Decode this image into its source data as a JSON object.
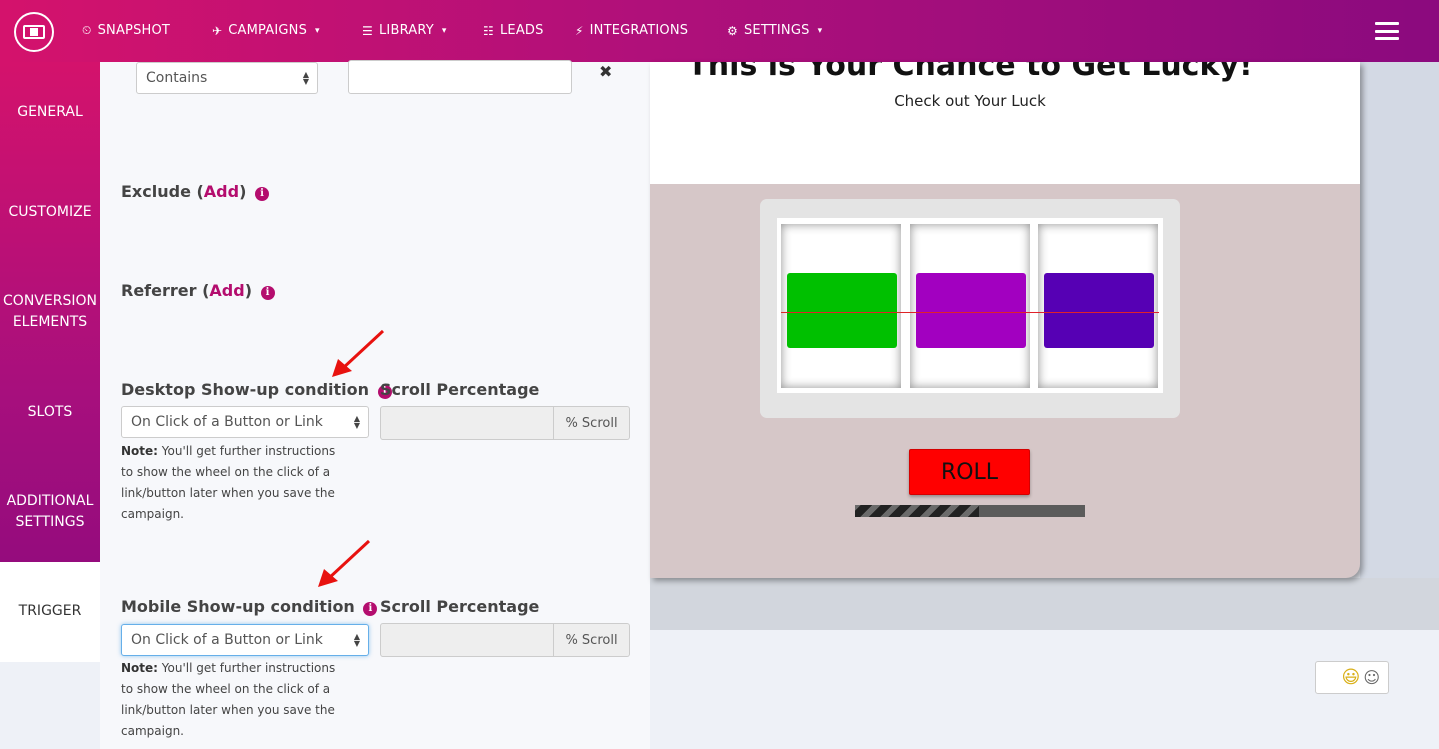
{
  "nav": {
    "items": [
      {
        "label": "SNAPSHOT",
        "icon": "dashboard-icon",
        "glyph": "⏲",
        "caret": false
      },
      {
        "label": "CAMPAIGNS",
        "icon": "paper-plane-icon",
        "glyph": "✈",
        "caret": true
      },
      {
        "label": "LIBRARY",
        "icon": "library-icon",
        "glyph": "☰",
        "caret": true
      },
      {
        "label": "LEADS",
        "icon": "list-icon",
        "glyph": "☷",
        "caret": false
      },
      {
        "label": "INTEGRATIONS",
        "icon": "plug-icon",
        "glyph": "⚡",
        "caret": false
      },
      {
        "label": "SETTINGS",
        "icon": "cogs-icon",
        "glyph": "⚙",
        "caret": true
      }
    ],
    "caret_glyph": "▾"
  },
  "sidebar": {
    "items": [
      {
        "label": "GENERAL",
        "active": false
      },
      {
        "label": "CUSTOMIZE",
        "active": false
      },
      {
        "label": "CONVERSION ELEMENTS",
        "active": false
      },
      {
        "label": "SLOTS",
        "active": false
      },
      {
        "label": "ADDITIONAL SETTINGS",
        "active": false
      },
      {
        "label": "TRIGGER",
        "active": true
      }
    ]
  },
  "form": {
    "contains_select": "Contains",
    "contains_value": "",
    "remove_glyph": "✖",
    "exclude": {
      "label": "Exclude (",
      "add": "Add",
      "close": ")"
    },
    "referrer": {
      "label": "Referrer (",
      "add": "Add",
      "close": ")"
    },
    "info_glyph": "i",
    "desktop": {
      "label": "Desktop Show-up condition",
      "select": "On Click of a Button or Link",
      "scroll_label": "Scroll Percentage",
      "scroll_addon": "% Scroll",
      "note_bold": "Note:",
      "note_text": " You'll get further instructions to show the wheel on the click of a link/button later when you save the campaign."
    },
    "mobile": {
      "label": "Mobile Show-up condition",
      "select": "On Click of a Button or Link",
      "scroll_label": "Scroll Percentage",
      "scroll_addon": "% Scroll",
      "note_bold": "Note:",
      "note_text": " You'll get further instructions to show the wheel on the click of a link/button later when you save the campaign."
    }
  },
  "preview": {
    "heading": "This is Your Chance to Get Lucky!",
    "subtitle": "Check out Your Luck",
    "roll_label": "ROLL",
    "progress": 0.54,
    "reels": [
      "#00c000",
      "#a200c0",
      "#5600b4"
    ]
  },
  "colors": {
    "accent": "#b40d6e",
    "arrow": "#e8120f"
  },
  "emoji_glyphs": {
    "smile_plus": "😃",
    "plus": "+",
    "smile": "☺"
  }
}
